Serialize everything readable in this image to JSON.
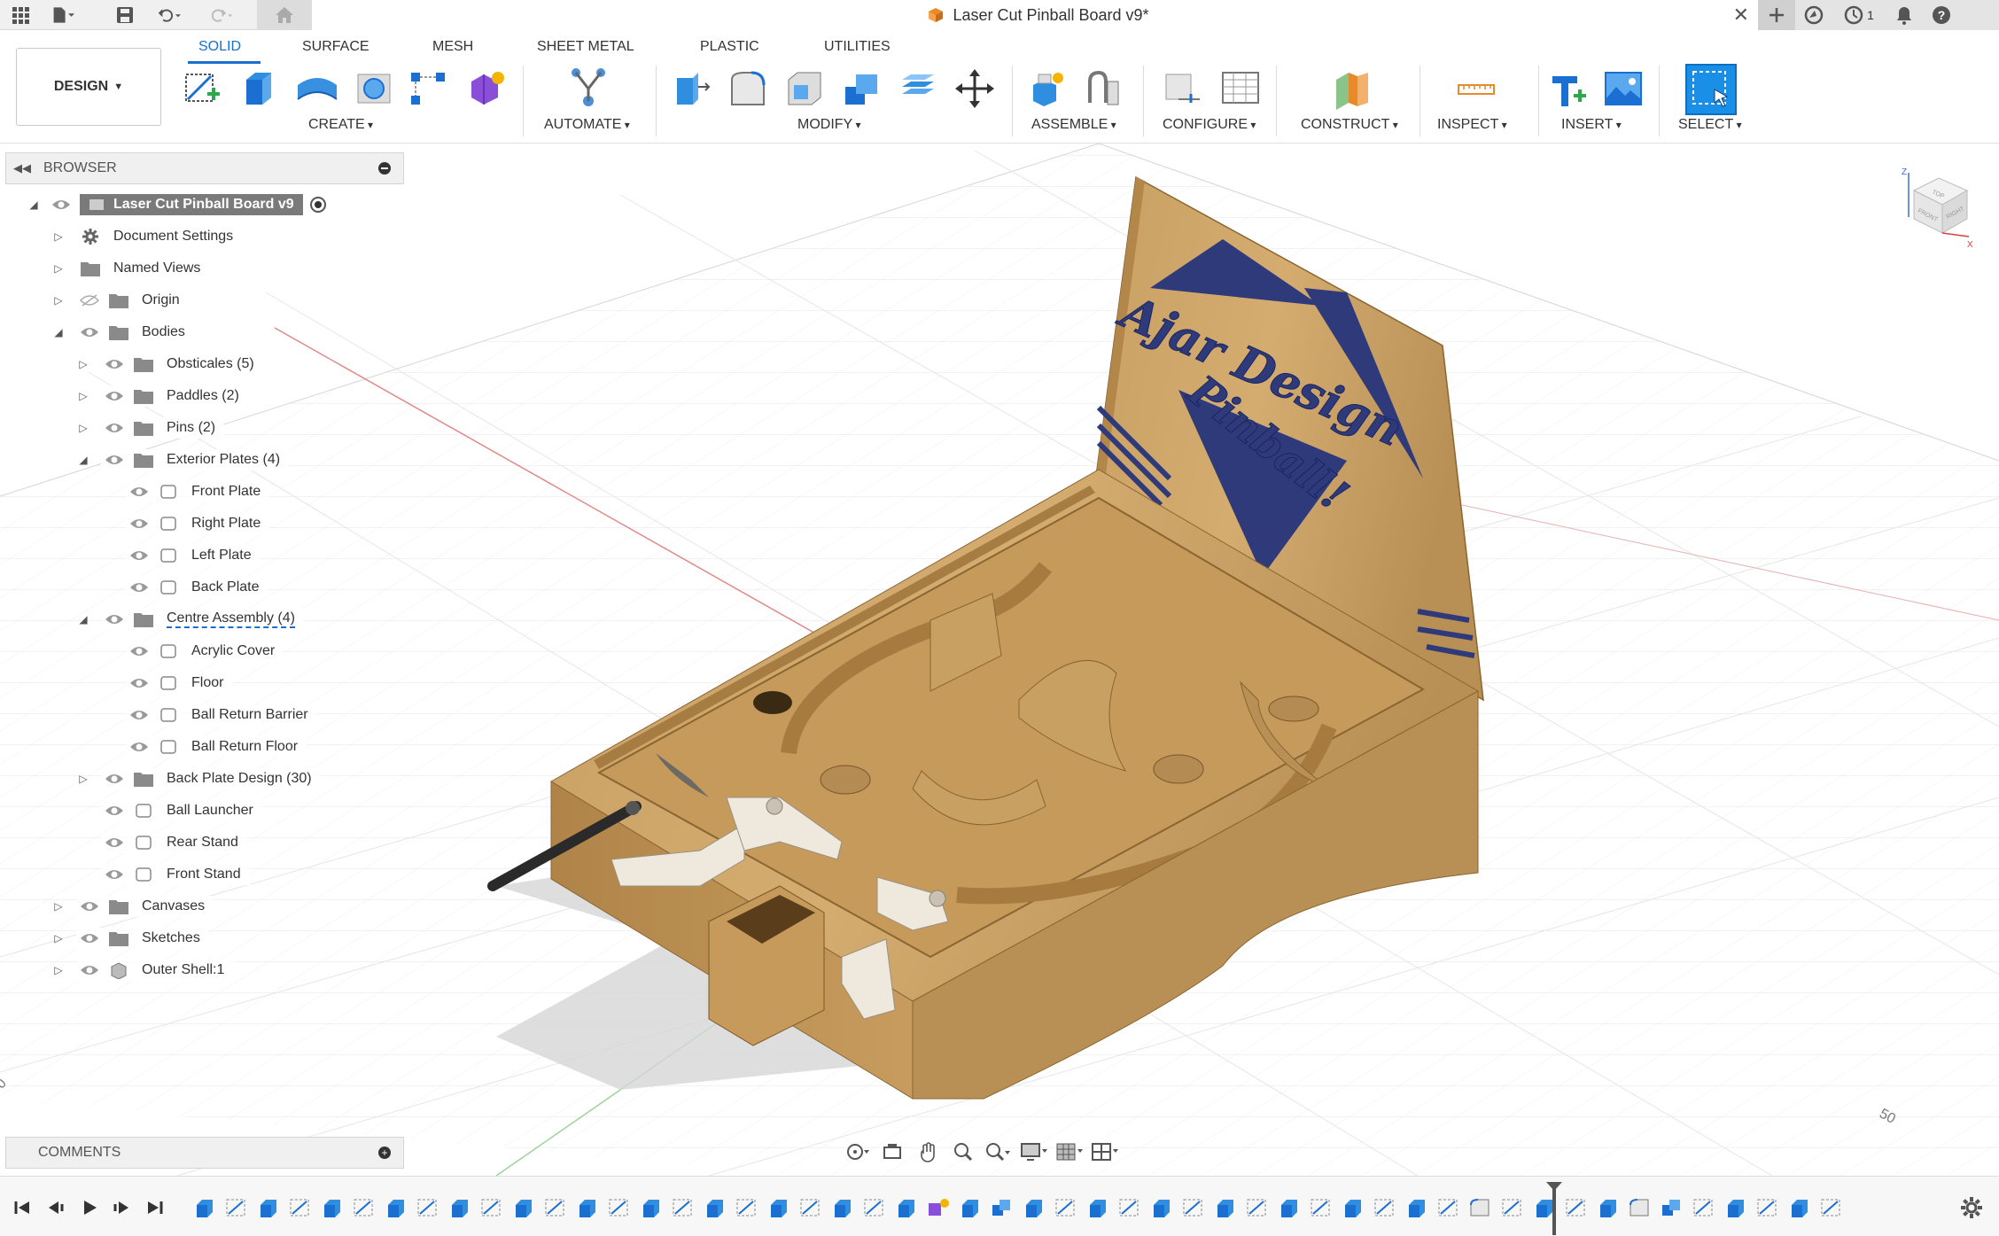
{
  "window": {
    "document_title": "Laser Cut Pinball Board v9*",
    "notifications_count": "1"
  },
  "toolbar": {
    "workspace_button": "DESIGN",
    "tabs": [
      "SOLID",
      "SURFACE",
      "MESH",
      "SHEET METAL",
      "PLASTIC",
      "UTILITIES"
    ],
    "active_tab": "SOLID",
    "groups": {
      "create": "CREATE",
      "automate": "AUTOMATE",
      "modify": "MODIFY",
      "assemble": "ASSEMBLE",
      "configure": "CONFIGURE",
      "construct": "CONSTRUCT",
      "inspect": "INSPECT",
      "insert": "INSERT",
      "select": "SELECT"
    },
    "accent_color": "#1a6fd0"
  },
  "browser": {
    "title": "BROWSER",
    "root": "Laser Cut Pinball Board v9",
    "items": [
      {
        "label": "Document Settings",
        "icon": "gear-icon"
      },
      {
        "label": "Named Views",
        "icon": "folder-icon"
      },
      {
        "label": "Origin",
        "icon": "folder-icon"
      },
      {
        "label": "Bodies",
        "icon": "folder-icon"
      },
      {
        "label": "Obsticales (5)",
        "icon": "folder-icon"
      },
      {
        "label": "Paddles (2)",
        "icon": "folder-icon"
      },
      {
        "label": "Pins (2)",
        "icon": "folder-icon"
      },
      {
        "label": "Exterior Plates (4)",
        "icon": "folder-icon"
      },
      {
        "label": "Front Plate",
        "icon": "body-icon"
      },
      {
        "label": "Right Plate",
        "icon": "body-icon"
      },
      {
        "label": "Left Plate",
        "icon": "body-icon"
      },
      {
        "label": "Back Plate",
        "icon": "body-icon"
      },
      {
        "label": "Centre Assembly (4)",
        "icon": "folder-icon"
      },
      {
        "label": "Acrylic Cover",
        "icon": "body-icon"
      },
      {
        "label": "Floor",
        "icon": "body-icon"
      },
      {
        "label": "Ball Return Barrier",
        "icon": "body-icon"
      },
      {
        "label": "Ball Return Floor",
        "icon": "body-icon"
      },
      {
        "label": "Back Plate Design (30)",
        "icon": "folder-icon"
      },
      {
        "label": "Ball Launcher",
        "icon": "body-icon"
      },
      {
        "label": "Rear Stand",
        "icon": "body-icon"
      },
      {
        "label": "Front Stand",
        "icon": "body-icon"
      },
      {
        "label": "Canvases",
        "icon": "folder-icon"
      },
      {
        "label": "Sketches",
        "icon": "folder-icon"
      },
      {
        "label": "Outer Shell:1",
        "icon": "component-icon"
      }
    ]
  },
  "comments": {
    "title": "COMMENTS"
  },
  "viewport": {
    "backplate_line1": "Ajar Design",
    "backplate_line2": "Pinball!",
    "grid_label_left": "0",
    "grid_label_right": "50",
    "wood_color": "#c9a063",
    "logo_color": "#2e3a7a"
  },
  "viewcube": {
    "top": "TOP",
    "front": "FRONT",
    "right": "RIGHT",
    "z": "Z",
    "x": "X"
  }
}
